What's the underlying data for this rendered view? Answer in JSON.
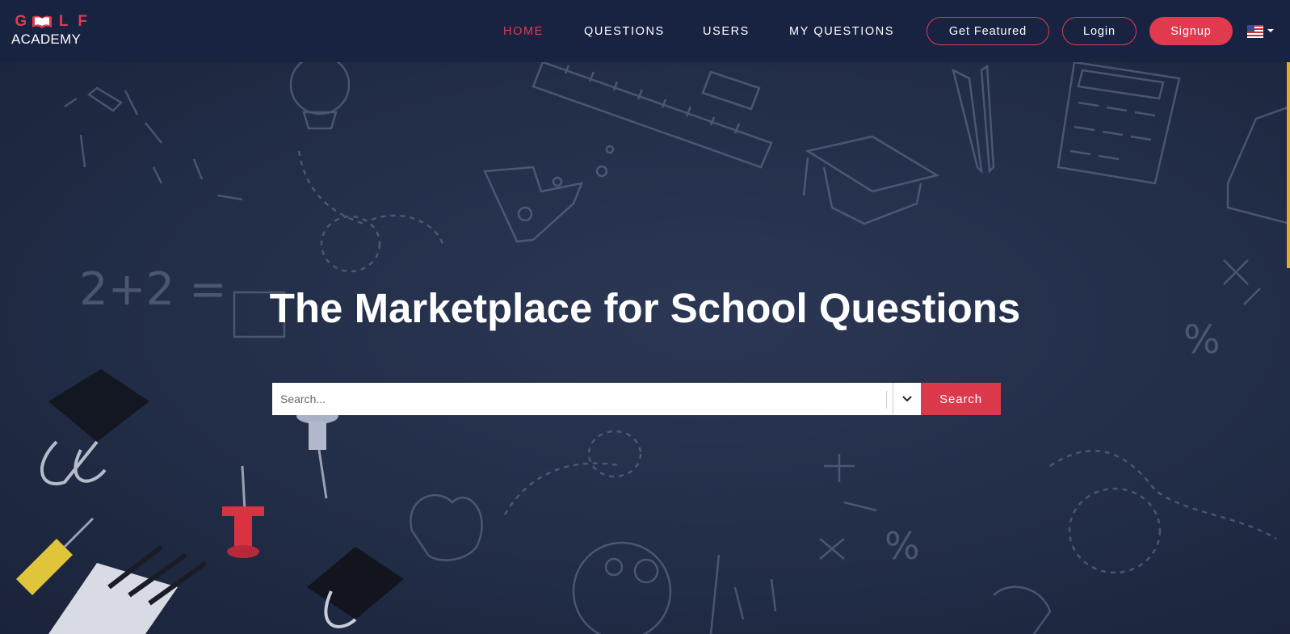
{
  "brand": {
    "logo_letters": [
      "G",
      "L",
      "F"
    ],
    "logo_subtitle": "ACADEMY",
    "accent_color": "#e03a4f"
  },
  "nav": {
    "items": [
      {
        "label": "HOME",
        "active": true
      },
      {
        "label": "QUESTIONS",
        "active": false
      },
      {
        "label": "USERS",
        "active": false
      },
      {
        "label": "MY QUESTIONS",
        "active": false
      }
    ],
    "get_featured_label": "Get Featured",
    "login_label": "Login",
    "signup_label": "Signup",
    "language_icon": "us-flag-icon"
  },
  "hero": {
    "title": "The Marketplace for School Questions",
    "search": {
      "placeholder": "Search...",
      "value": "",
      "button_label": "Search"
    }
  }
}
